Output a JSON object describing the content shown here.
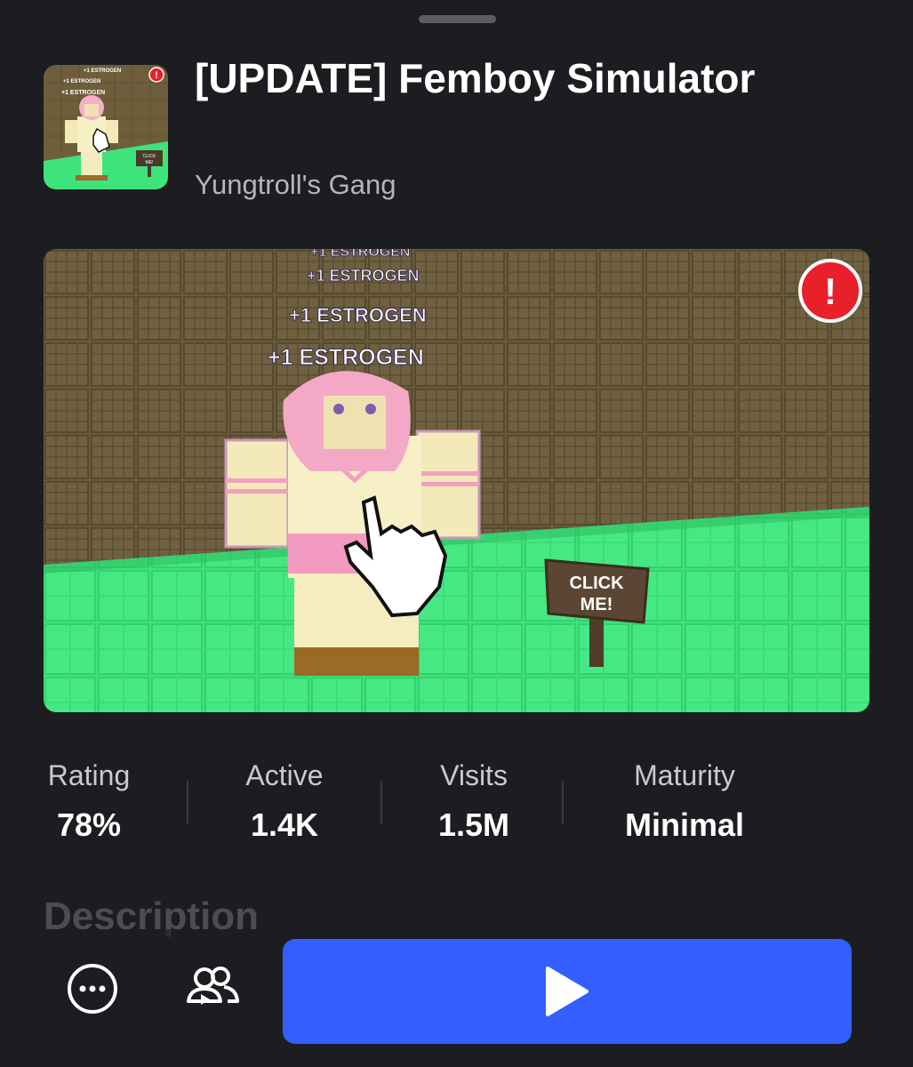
{
  "game": {
    "title": "[UPDATE] Femboy Simulator",
    "creator": "Yungtroll's Gang"
  },
  "thumbnail": {
    "texts": [
      "+1 ESTROGEN",
      "+1 ESTROGEN",
      "+1 ESTROGEN",
      "CLICK",
      "ME!"
    ],
    "badge": "!"
  },
  "hero": {
    "texts": [
      "+1 ESTROGEN",
      "+1 ESTROGEN",
      "+1 ESTROGEN",
      "+1 ESTROGEN"
    ],
    "sign_line1": "CLICK",
    "sign_line2": "ME!",
    "badge": "!"
  },
  "stats": [
    {
      "label": "Rating",
      "value": "78%"
    },
    {
      "label": "Active",
      "value": "1.4K"
    },
    {
      "label": "Visits",
      "value": "1.5M"
    },
    {
      "label": "Maturity",
      "value": "Minimal"
    }
  ],
  "description": {
    "heading": "Description"
  },
  "icons": {
    "more": "more-options-icon",
    "friends": "friends-icon",
    "play": "play-icon"
  },
  "colors": {
    "background": "#1c1d21",
    "play_button": "#335fff",
    "badge_red": "#e8202a",
    "floor_green": "#3de07a"
  }
}
